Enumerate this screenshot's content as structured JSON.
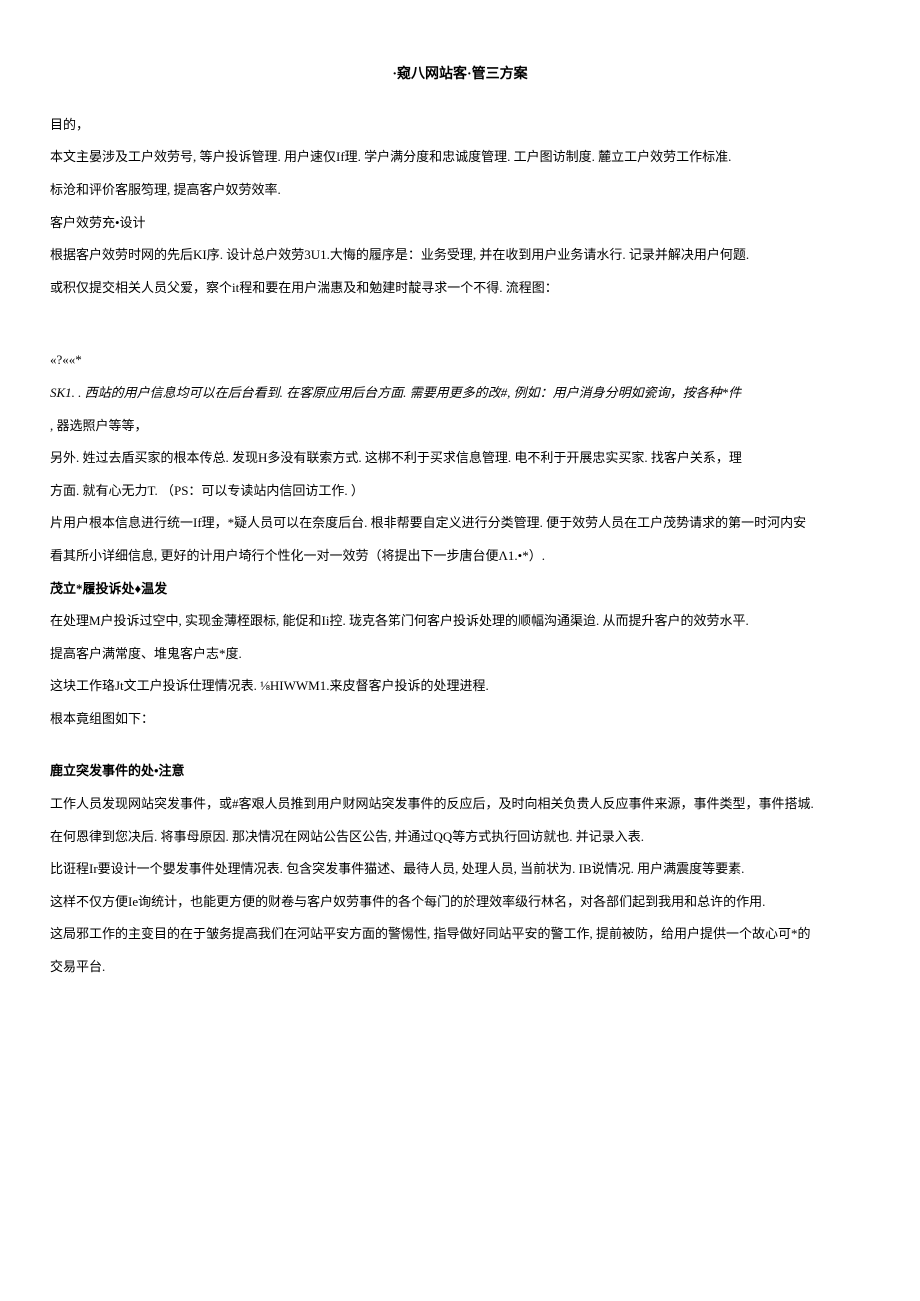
{
  "title": "·窥八网站客·管三方案",
  "p1": "目的，",
  "p2": "本文主晏涉及工户效劳号, 等户投诉管理. 用户速仅If理. 学户满分度和忠诚度管理. 工户图访制度. 麓立工户效劳工作标准.",
  "p3": "标沧和评价客服笉理, 提高客户奴劳效率.",
  "p4": "客户效劳充•设计",
  "p5": "根据客户效劳时网的先后KI序. 设计总户效劳3U1.大悔的履序是：业务受理, 并在收到用户业务请水行. 记录并解决用户何题.",
  "p6": "或积仅提交相关人员父爱，察个it程和要在用户湍惠及和勉建时靛寻求一个不得. 流程图：",
  "p7": "«?««*",
  "p8": "SK1. . 西站的用户信息均可以在后台看到. 在客原应用后台方面. 需要用更多的改#, 例如：用户消身分明如瓷询，按各种*件",
  "p9": ", 器选照户等等，",
  "p10": "另外. 姓过去盾买家的根本传总. 发现H多没有联索方式. 这梆不利于买求信息管理. 电不利于开展忠实买家. 找客户关系，理",
  "p11": "方面. 就有心无力T. （PS：可以专读站内信回访工作. ）",
  "p12": "片用户根本信息进行统一If理，*疑人员可以在奈度后台. 根非帮要自定义进行分类管理. 便于效劳人员在工户茂势请求的第一时河内安",
  "p13": "看其所小详细信息, 更好的计用户埼行个性化一对一效劳（将提出下一步唐台便Λ1.•*）.",
  "h1": "茂立*履投诉处♦温发",
  "p14": "在处理M户投诉过空中, 实现金薄桎跟标, 能促和Ii控. 珑克各笫门何客户投诉处理的顺幅沟通渠迨. 从而提升客户的效劳水平.",
  "p15": "提高客户满常度、堆鬼客户志*度.",
  "p16": "这块工作珞Jt文工户投诉仕理情况表. ⅛HIWWM1.来皮督客户投诉的处理进程.",
  "p17": "根本竟组图如下：",
  "h2": "鹿立突发事件的处•注意",
  "p18": "工作人员发现网站突发事件，或#客艰人员推到用户财网站突发事件的反应后，及时向相关负贵人反应事件来源，事件类型，事件搭城.",
  "p19": "在何恩律到您决后. 将事母原因. 那决情况在网站公告区公告, 并通过QQ等方式执行回访就也. 并记录入表.",
  "p20": "比诳程Ir要设计一个嬰发事件处理情况表. 包含突发事件猫述、最待人员, 处理人员, 当前状为. IB说情况. 用户满震度等要素.",
  "p21": "这样不仅方便Ie询统计，也能更方便的财卷与客户奴劳事件的各个每门的於理效率级行林名，对各部们起到我用和总许的作用.",
  "p22": "这局邪工作的主变目的在于皱务提高我们在河站平安方面的警惕性, 指导做好同站平安的警工作, 提前被防，给用户提供一个故心可*的",
  "p23": "交易平台."
}
